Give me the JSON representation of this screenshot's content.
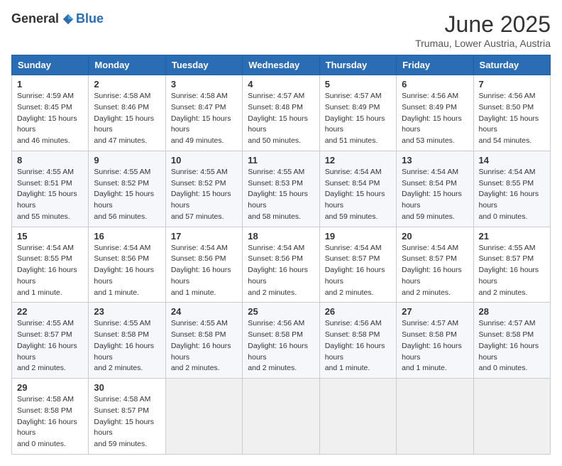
{
  "header": {
    "logo_general": "General",
    "logo_blue": "Blue",
    "month_title": "June 2025",
    "location": "Trumau, Lower Austria, Austria"
  },
  "calendar": {
    "headers": [
      "Sunday",
      "Monday",
      "Tuesday",
      "Wednesday",
      "Thursday",
      "Friday",
      "Saturday"
    ],
    "weeks": [
      [
        {
          "day": "1",
          "sunrise": "4:59 AM",
          "sunset": "8:45 PM",
          "daylight": "15 hours and 46 minutes."
        },
        {
          "day": "2",
          "sunrise": "4:58 AM",
          "sunset": "8:46 PM",
          "daylight": "15 hours and 47 minutes."
        },
        {
          "day": "3",
          "sunrise": "4:58 AM",
          "sunset": "8:47 PM",
          "daylight": "15 hours and 49 minutes."
        },
        {
          "day": "4",
          "sunrise": "4:57 AM",
          "sunset": "8:48 PM",
          "daylight": "15 hours and 50 minutes."
        },
        {
          "day": "5",
          "sunrise": "4:57 AM",
          "sunset": "8:49 PM",
          "daylight": "15 hours and 51 minutes."
        },
        {
          "day": "6",
          "sunrise": "4:56 AM",
          "sunset": "8:49 PM",
          "daylight": "15 hours and 53 minutes."
        },
        {
          "day": "7",
          "sunrise": "4:56 AM",
          "sunset": "8:50 PM",
          "daylight": "15 hours and 54 minutes."
        }
      ],
      [
        {
          "day": "8",
          "sunrise": "4:55 AM",
          "sunset": "8:51 PM",
          "daylight": "15 hours and 55 minutes."
        },
        {
          "day": "9",
          "sunrise": "4:55 AM",
          "sunset": "8:52 PM",
          "daylight": "15 hours and 56 minutes."
        },
        {
          "day": "10",
          "sunrise": "4:55 AM",
          "sunset": "8:52 PM",
          "daylight": "15 hours and 57 minutes."
        },
        {
          "day": "11",
          "sunrise": "4:55 AM",
          "sunset": "8:53 PM",
          "daylight": "15 hours and 58 minutes."
        },
        {
          "day": "12",
          "sunrise": "4:54 AM",
          "sunset": "8:54 PM",
          "daylight": "15 hours and 59 minutes."
        },
        {
          "day": "13",
          "sunrise": "4:54 AM",
          "sunset": "8:54 PM",
          "daylight": "15 hours and 59 minutes."
        },
        {
          "day": "14",
          "sunrise": "4:54 AM",
          "sunset": "8:55 PM",
          "daylight": "16 hours and 0 minutes."
        }
      ],
      [
        {
          "day": "15",
          "sunrise": "4:54 AM",
          "sunset": "8:55 PM",
          "daylight": "16 hours and 1 minute."
        },
        {
          "day": "16",
          "sunrise": "4:54 AM",
          "sunset": "8:56 PM",
          "daylight": "16 hours and 1 minute."
        },
        {
          "day": "17",
          "sunrise": "4:54 AM",
          "sunset": "8:56 PM",
          "daylight": "16 hours and 1 minute."
        },
        {
          "day": "18",
          "sunrise": "4:54 AM",
          "sunset": "8:56 PM",
          "daylight": "16 hours and 2 minutes."
        },
        {
          "day": "19",
          "sunrise": "4:54 AM",
          "sunset": "8:57 PM",
          "daylight": "16 hours and 2 minutes."
        },
        {
          "day": "20",
          "sunrise": "4:54 AM",
          "sunset": "8:57 PM",
          "daylight": "16 hours and 2 minutes."
        },
        {
          "day": "21",
          "sunrise": "4:55 AM",
          "sunset": "8:57 PM",
          "daylight": "16 hours and 2 minutes."
        }
      ],
      [
        {
          "day": "22",
          "sunrise": "4:55 AM",
          "sunset": "8:57 PM",
          "daylight": "16 hours and 2 minutes."
        },
        {
          "day": "23",
          "sunrise": "4:55 AM",
          "sunset": "8:58 PM",
          "daylight": "16 hours and 2 minutes."
        },
        {
          "day": "24",
          "sunrise": "4:55 AM",
          "sunset": "8:58 PM",
          "daylight": "16 hours and 2 minutes."
        },
        {
          "day": "25",
          "sunrise": "4:56 AM",
          "sunset": "8:58 PM",
          "daylight": "16 hours and 2 minutes."
        },
        {
          "day": "26",
          "sunrise": "4:56 AM",
          "sunset": "8:58 PM",
          "daylight": "16 hours and 1 minute."
        },
        {
          "day": "27",
          "sunrise": "4:57 AM",
          "sunset": "8:58 PM",
          "daylight": "16 hours and 1 minute."
        },
        {
          "day": "28",
          "sunrise": "4:57 AM",
          "sunset": "8:58 PM",
          "daylight": "16 hours and 0 minutes."
        }
      ],
      [
        {
          "day": "29",
          "sunrise": "4:58 AM",
          "sunset": "8:58 PM",
          "daylight": "16 hours and 0 minutes."
        },
        {
          "day": "30",
          "sunrise": "4:58 AM",
          "sunset": "8:57 PM",
          "daylight": "15 hours and 59 minutes."
        },
        null,
        null,
        null,
        null,
        null
      ]
    ]
  }
}
